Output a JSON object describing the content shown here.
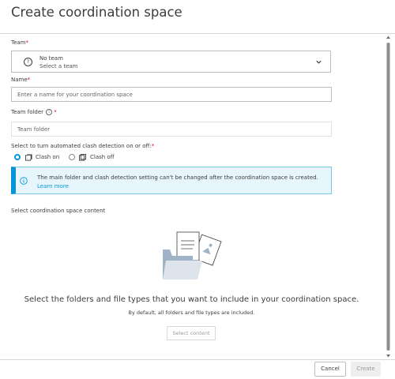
{
  "dialog": {
    "title": "Create coordination space"
  },
  "team": {
    "label": "Team",
    "required_mark": "*",
    "selected_value": "No team",
    "hint": "Select a team"
  },
  "name": {
    "label": "Name",
    "required_mark": "*",
    "placeholder": "Enter a name for your coordination space",
    "value": ""
  },
  "team_folder": {
    "label": "Team folder",
    "required_mark": "*",
    "placeholder": "Team folder",
    "value": ""
  },
  "clash": {
    "label": "Select to turn automated clash detection on or off:",
    "required_mark": "*",
    "options": [
      {
        "label": "Clash on",
        "selected": true
      },
      {
        "label": "Clash off",
        "selected": false
      }
    ]
  },
  "banner": {
    "text": "The main folder and clash detection setting can't be changed after the coordination space is created.",
    "link_text": "Learn more",
    "accent_color": "#0696d7"
  },
  "content": {
    "section_label": "Select coordination space content",
    "empty_title": "Select the folders and file types that you want to include in your coordination space.",
    "empty_subtitle": "By default, all folders and file types are included.",
    "select_button": "Select content"
  },
  "footer": {
    "cancel_label": "Cancel",
    "create_label": "Create"
  }
}
